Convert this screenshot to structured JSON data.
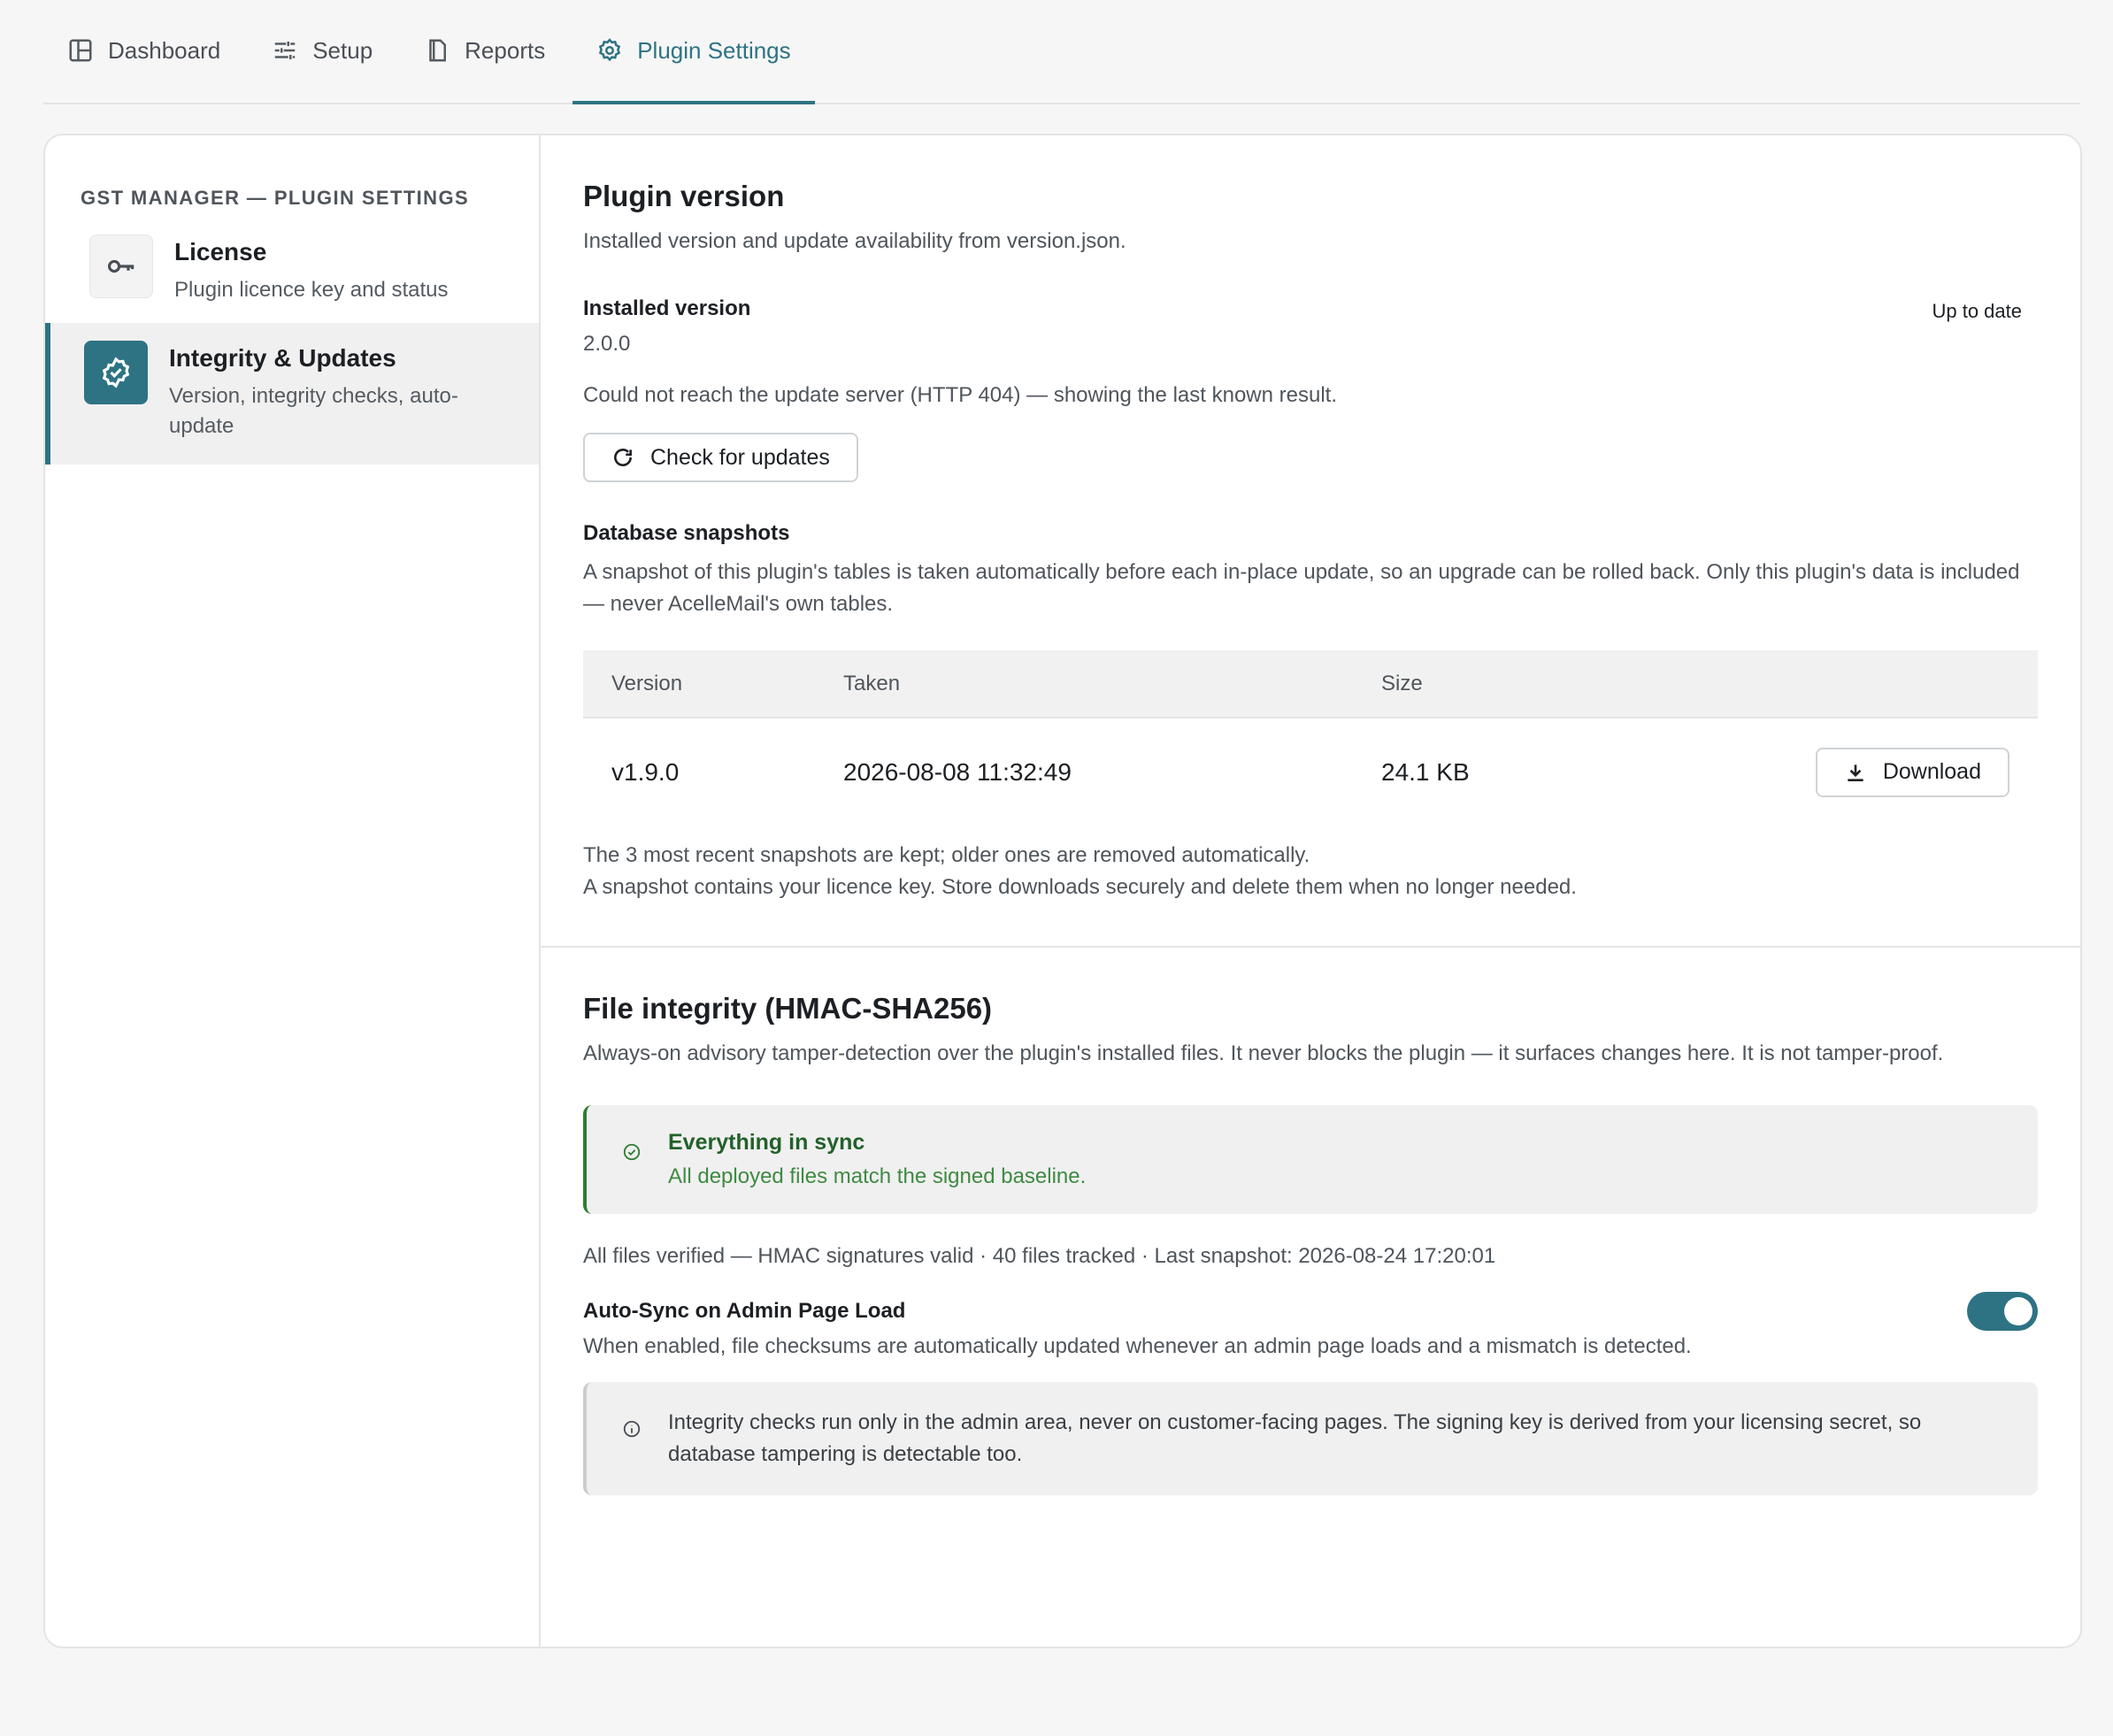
{
  "tabs": [
    {
      "label": "Dashboard",
      "icon": "layout-icon"
    },
    {
      "label": "Setup",
      "icon": "sliders-icon"
    },
    {
      "label": "Reports",
      "icon": "document-icon"
    },
    {
      "label": "Plugin Settings",
      "icon": "gear-icon",
      "active": true
    }
  ],
  "sidebar": {
    "heading": "GST Manager — Plugin Settings",
    "items": [
      {
        "title": "License",
        "desc": "Plugin licence key and status",
        "icon": "key-icon"
      },
      {
        "title": "Integrity & Updates",
        "desc": "Version, integrity checks, auto-update",
        "icon": "badge-check-icon",
        "active": true
      }
    ]
  },
  "version": {
    "title": "Plugin version",
    "desc": "Installed version and update availability from version.json.",
    "installed_label": "Installed version",
    "installed_value": "2.0.0",
    "status": "Up to date",
    "error": "Could not reach the update server (HTTP 404) — showing the last known result.",
    "check_button": "Check for updates"
  },
  "snapshots": {
    "title": "Database snapshots",
    "desc": "A snapshot of this plugin's tables is taken automatically before each in-place update, so an upgrade can be rolled back. Only this plugin's data is included — never AcelleMail's own tables.",
    "columns": [
      "Version",
      "Taken",
      "Size"
    ],
    "rows": [
      {
        "version": "v1.9.0",
        "taken": "2026-08-08 11:32:49",
        "size": "24.1 KB",
        "action": "Download"
      }
    ],
    "note1": "The 3 most recent snapshots are kept; older ones are removed automatically.",
    "note2": "A snapshot contains your licence key. Store downloads securely and delete them when no longer needed."
  },
  "integrity": {
    "title": "File integrity (HMAC-SHA256)",
    "desc": "Always-on advisory tamper-detection over the plugin's installed files. It never blocks the plugin — it surfaces changes here. It is not tamper-proof.",
    "status_title": "Everything in sync",
    "status_body": "All deployed files match the signed baseline.",
    "summary": "All files verified — HMAC signatures valid · 40 files tracked · Last snapshot: 2026-08-24 17:20:01",
    "autosync_label": "Auto-Sync on Admin Page Load",
    "autosync_desc": "When enabled, file checksums are automatically updated whenever an admin page loads and a mismatch is detected.",
    "autosync_enabled": true,
    "info": "Integrity checks run only in the admin area, never on customer-facing pages. The signing key is derived from your licensing secret, so database tampering is detectable too."
  },
  "colors": {
    "accent": "#2d7384",
    "success": "#2e7d32",
    "background": "#f6f6f6"
  }
}
